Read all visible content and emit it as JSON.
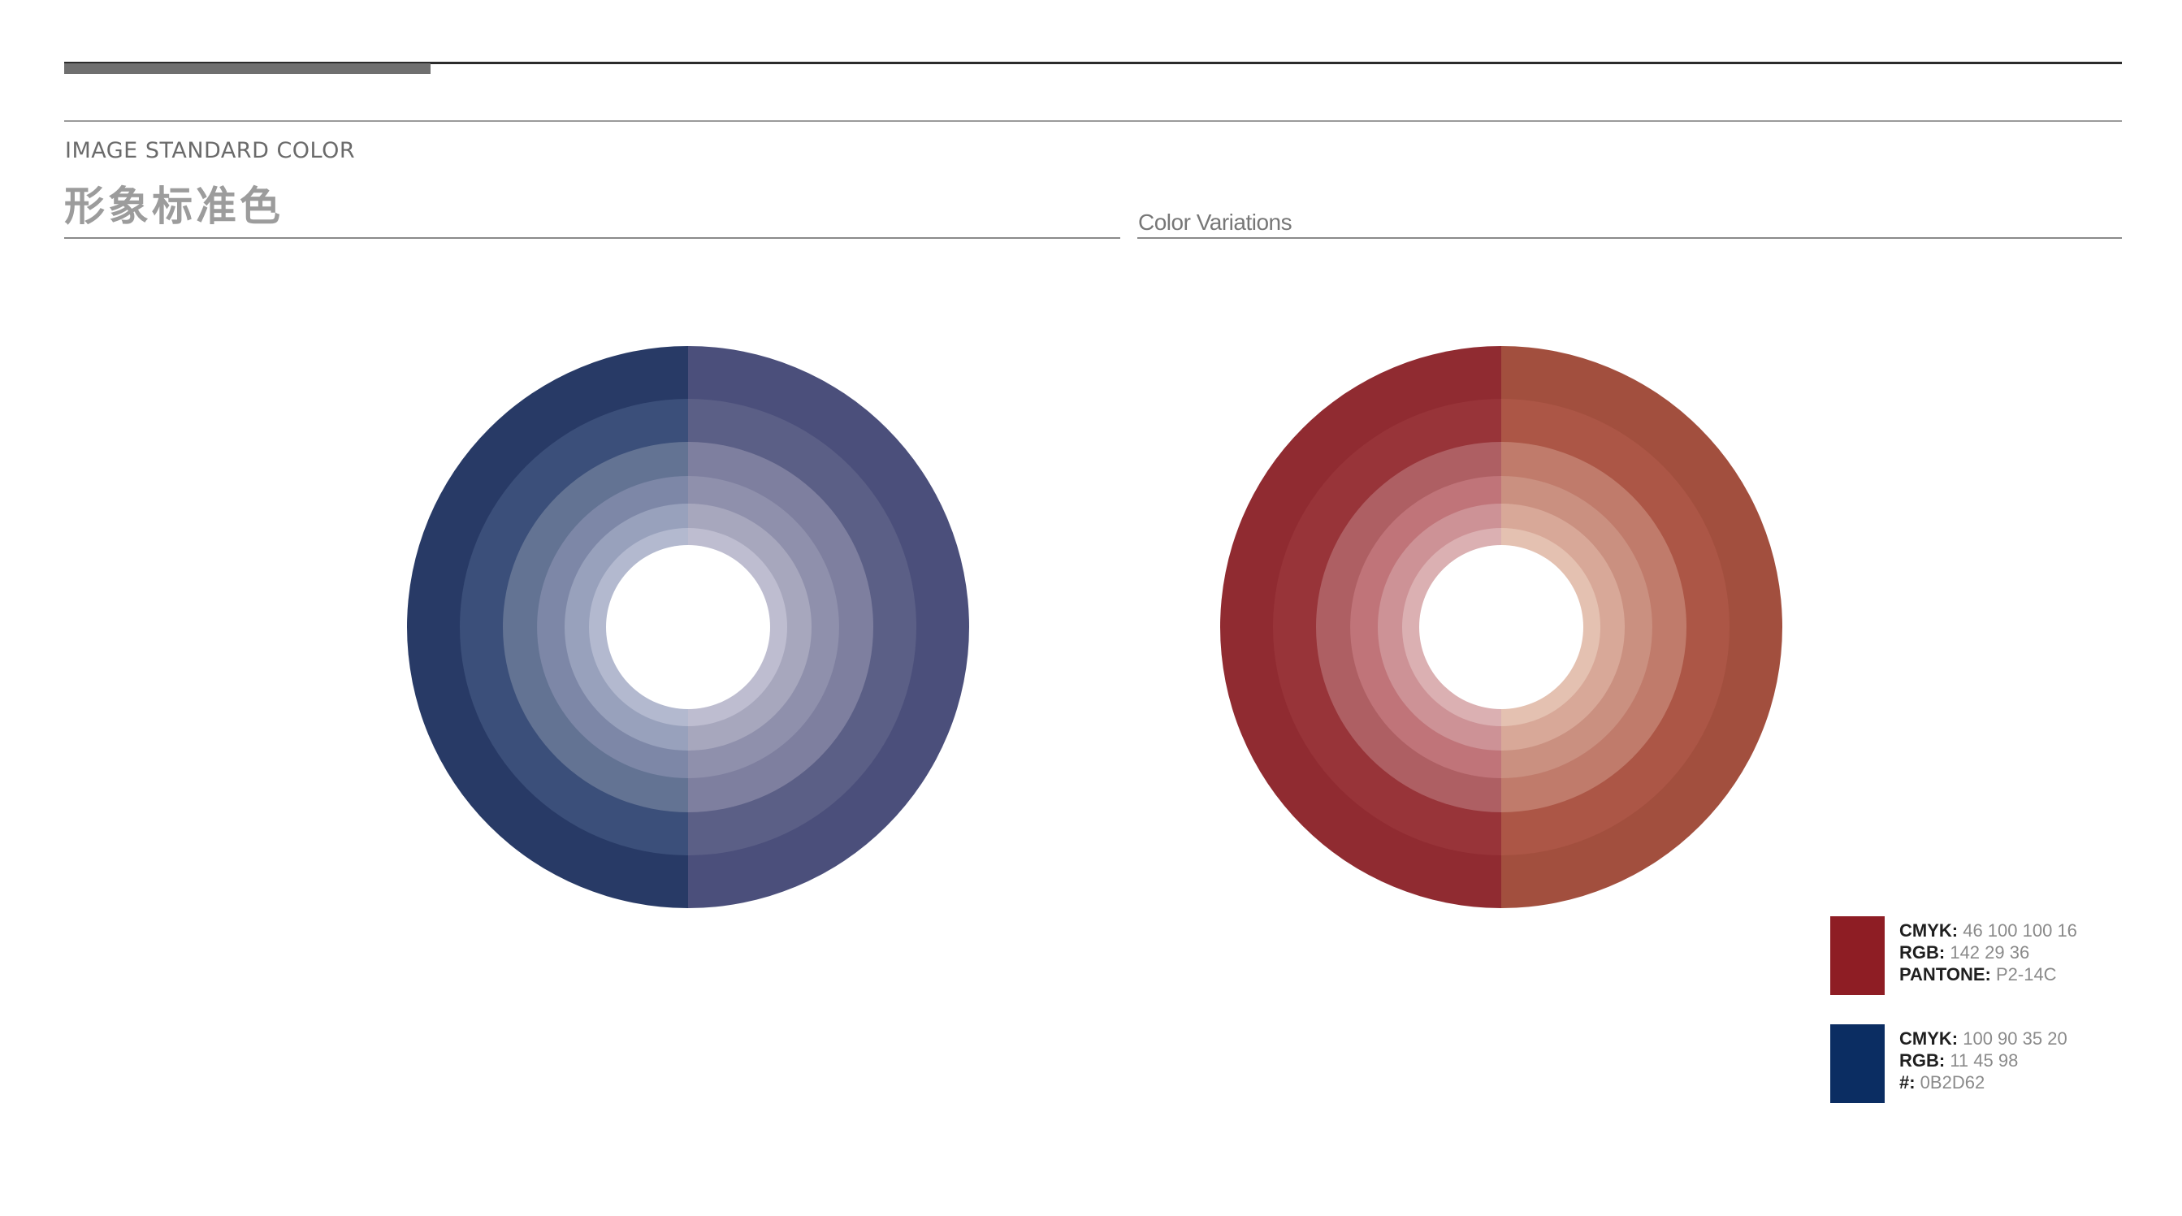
{
  "header": {
    "title_en": "IMAGE STANDARD COLOR",
    "title_cn": "形象标准色",
    "subtitle": "Color Variations"
  },
  "colors": {
    "red": "#8E1D24",
    "navy": "#0B2D62",
    "rule_dark": "#2b2b2b",
    "rule_accent": "#6f6f6f"
  },
  "rings": {
    "blue": {
      "left": [
        "#283a66",
        "#3b4f7a",
        "#637393",
        "#7d87a7",
        "#98a1bc",
        "#b3b9cf"
      ],
      "right": [
        "#4b4f7b",
        "#5b5f86",
        "#7e7f9f",
        "#8f90ac",
        "#a7a7bd",
        "#bebdd0"
      ]
    },
    "red": {
      "left": [
        "#902b31",
        "#983439",
        "#ae5f63",
        "#c07479",
        "#cd9296",
        "#dbb0b2"
      ],
      "right": [
        "#a24f3e",
        "#ac5646",
        "#c07b6b",
        "#ca9080",
        "#d8a898",
        "#e4c1b1"
      ]
    }
  },
  "swatches": [
    {
      "color": "#8E1D24",
      "lines": [
        {
          "key": "CMYK:",
          "value": " 46 100 100 16"
        },
        {
          "key": "RGB:",
          "value": " 142 29 36"
        },
        {
          "key": "PANTONE:",
          "value": " P2-14C"
        }
      ]
    },
    {
      "color": "#0B2D62",
      "lines": [
        {
          "key": "CMYK:",
          "value": " 100 90 35 20"
        },
        {
          "key": "RGB:",
          "value": " 11 45 98"
        },
        {
          "key": "#:",
          "value": " 0B2D62"
        }
      ]
    }
  ]
}
